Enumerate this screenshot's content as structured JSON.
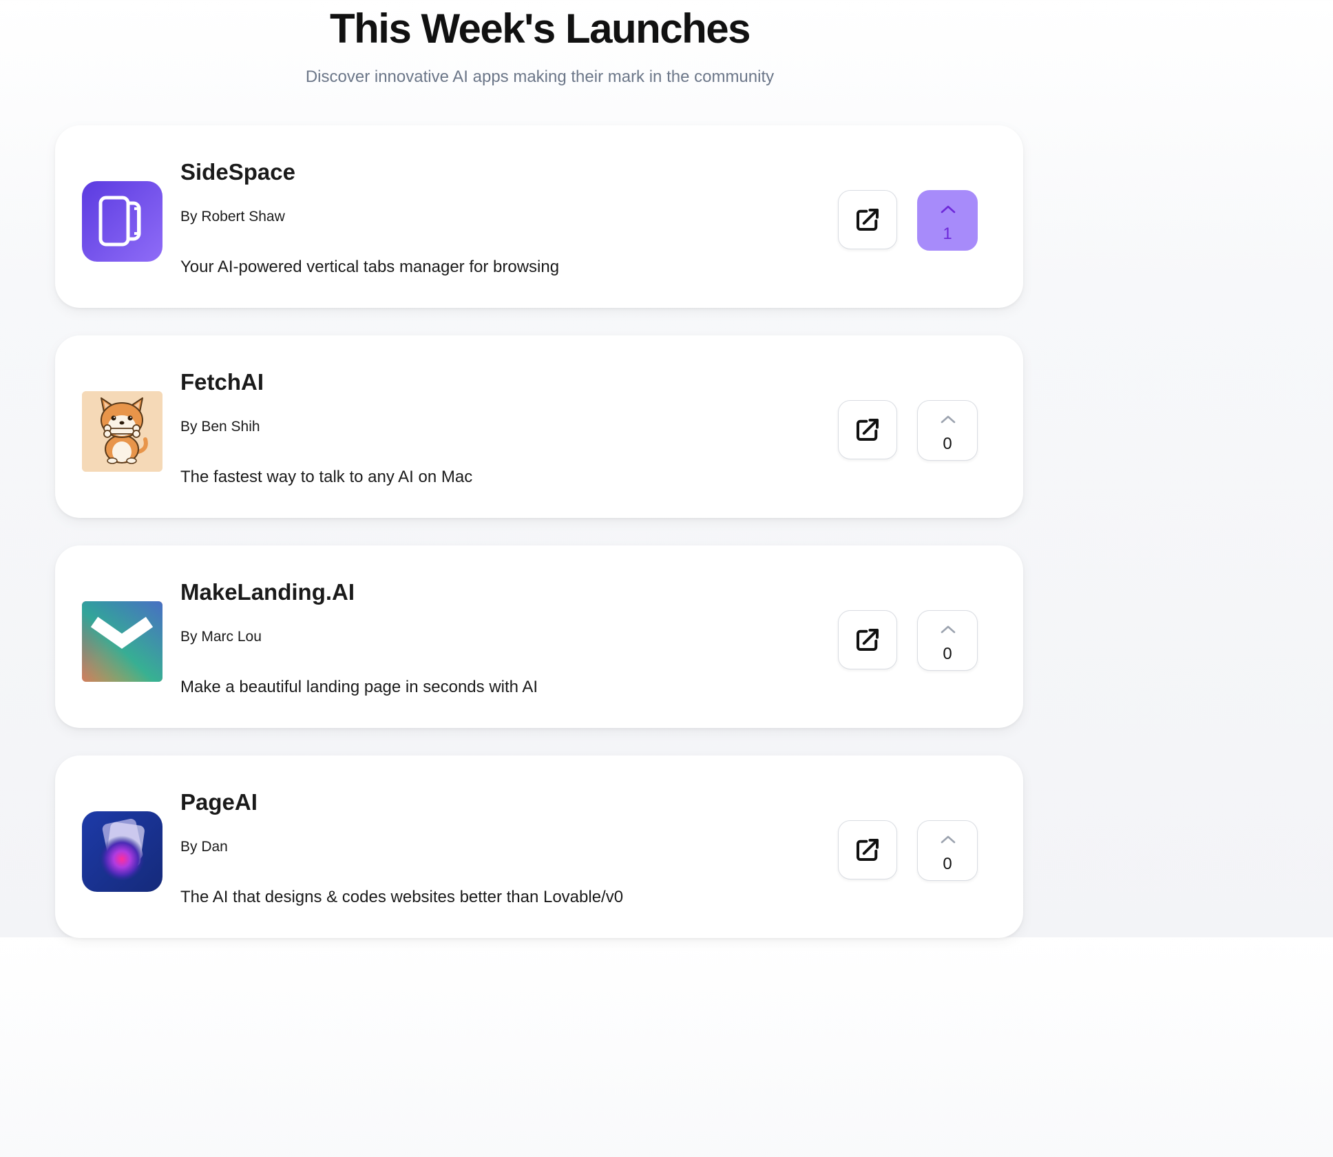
{
  "header": {
    "title": "This Week's Launches",
    "subtitle": "Discover innovative AI apps making their mark in the community"
  },
  "colors": {
    "accent": "#a78bfa",
    "accent_text": "#6d28d9",
    "subtitle": "#6b7688"
  },
  "launches": [
    {
      "name": "SideSpace",
      "author": "By Robert Shaw",
      "description": "Your AI-powered vertical tabs manager for browsing",
      "upvotes": "1",
      "upvoted": true,
      "logo_icon": "sidespace-logo-icon"
    },
    {
      "name": "FetchAI",
      "author": "By Ben Shih",
      "description": "The fastest way to talk to any AI on Mac",
      "upvotes": "0",
      "upvoted": false,
      "logo_icon": "shiba-dog-logo-icon"
    },
    {
      "name": "MakeLanding.AI",
      "author": "By Marc Lou",
      "description": "Make a beautiful landing page in seconds with AI",
      "upvotes": "0",
      "upvoted": false,
      "logo_icon": "makelanding-logo-icon"
    },
    {
      "name": "PageAI",
      "author": "By Dan",
      "description": "The AI that designs & codes websites better than Lovable/v0",
      "upvotes": "0",
      "upvoted": false,
      "logo_icon": "pageai-logo-icon"
    }
  ]
}
